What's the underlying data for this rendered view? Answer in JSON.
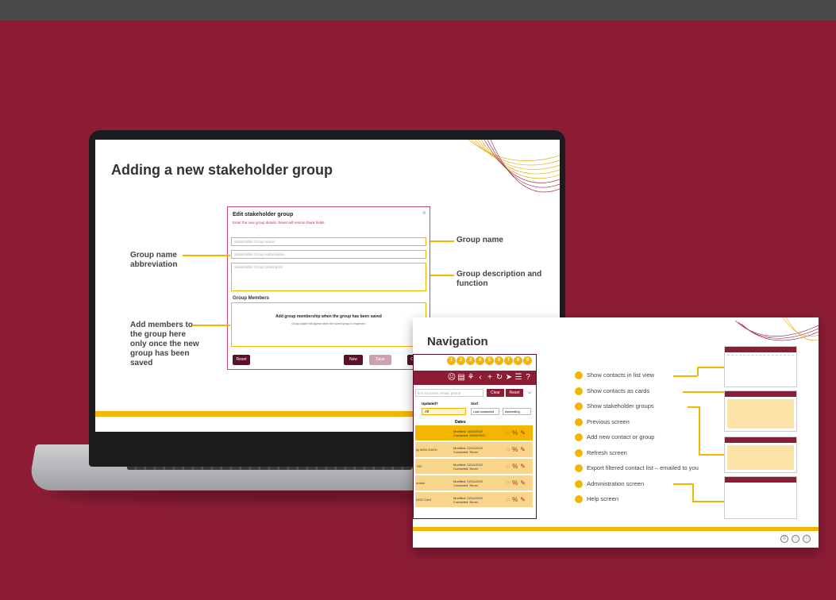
{
  "laptop_slide": {
    "title": "Adding a new stakeholder group",
    "dialog": {
      "title": "Edit stakeholder group",
      "subtitle": "Enter the new group details. Reset will restore blank fields.",
      "name_placeholder": "Stakeholder Group Name",
      "abbrev_placeholder": "Stakeholder Group Abbreviation",
      "desc_placeholder": "Stakeholder Group Description",
      "members_heading": "Group Members",
      "members_note": "Add group membership when the group has been saved",
      "members_small": "Group picker will appear when the saved group is reopened.",
      "reset_label": "Reset",
      "new_label": "New",
      "save_label": "Save",
      "close_label": "C",
      "close_icon": "×"
    },
    "callouts": {
      "abbrev": "Group name abbreviation",
      "members": "Add members to the group here only once the new group has been saved",
      "name": "Group name",
      "desc": "Group description and function"
    }
  },
  "nav_slide": {
    "title": "Navigation",
    "numbers": [
      "1",
      "2",
      "3",
      "4",
      "5",
      "6",
      "7",
      "8",
      "9"
    ],
    "icons": [
      "person-icon",
      "cards-icon",
      "groups-icon",
      "back-icon",
      "add-icon",
      "refresh-icon",
      "export-icon",
      "admin-icon",
      "help-icon"
    ],
    "icon_glyphs": [
      "☹",
      "▤",
      "⚘",
      "‹",
      "+",
      "↻",
      "➤",
      "☰",
      "?"
    ],
    "search_placeholder": "first surname, email, phone",
    "clear_label": "Clear",
    "reset_label": "Reset",
    "updated_label": "Updated?",
    "updated_value": "All",
    "sort_label": "Sort",
    "sort_value": "Last contacted",
    "order_value": "Ascending",
    "dates_heading": "Dates",
    "rows": [
      {
        "name": "",
        "modified": "Modified: 16/11/2022",
        "contacted": "Contacted: 05/09/2022"
      },
      {
        "name": "ky AHDI DASH",
        "modified": "Modified: 02/11/2022",
        "contacted": "Contacted: Never"
      },
      {
        "name": "TS2",
        "modified": "Modified: 02/11/2022",
        "contacted": "Contacted: Never"
      },
      {
        "name": "ontact",
        "modified": "Modified: 02/11/2022",
        "contacted": "Contacted: Never"
      },
      {
        "name": "DGO Corr!",
        "modified": "Modified: 02/11/2022",
        "contacted": "Contacted: Never"
      }
    ],
    "items": [
      "Show contacts in list view",
      "Show contacts as cards",
      "Show stakeholder groups",
      "Previous screen",
      "Add new contact or group",
      "Refresh screen",
      "Export filtered contact list – emailed to you",
      "Administration screen",
      "Help screen"
    ],
    "cc_icons": [
      "©",
      "ⓘ",
      "ⓘ"
    ]
  },
  "colors": {
    "background": "#8c1d35",
    "accent": "#f2b600",
    "topbar": "#4a4a4a"
  }
}
